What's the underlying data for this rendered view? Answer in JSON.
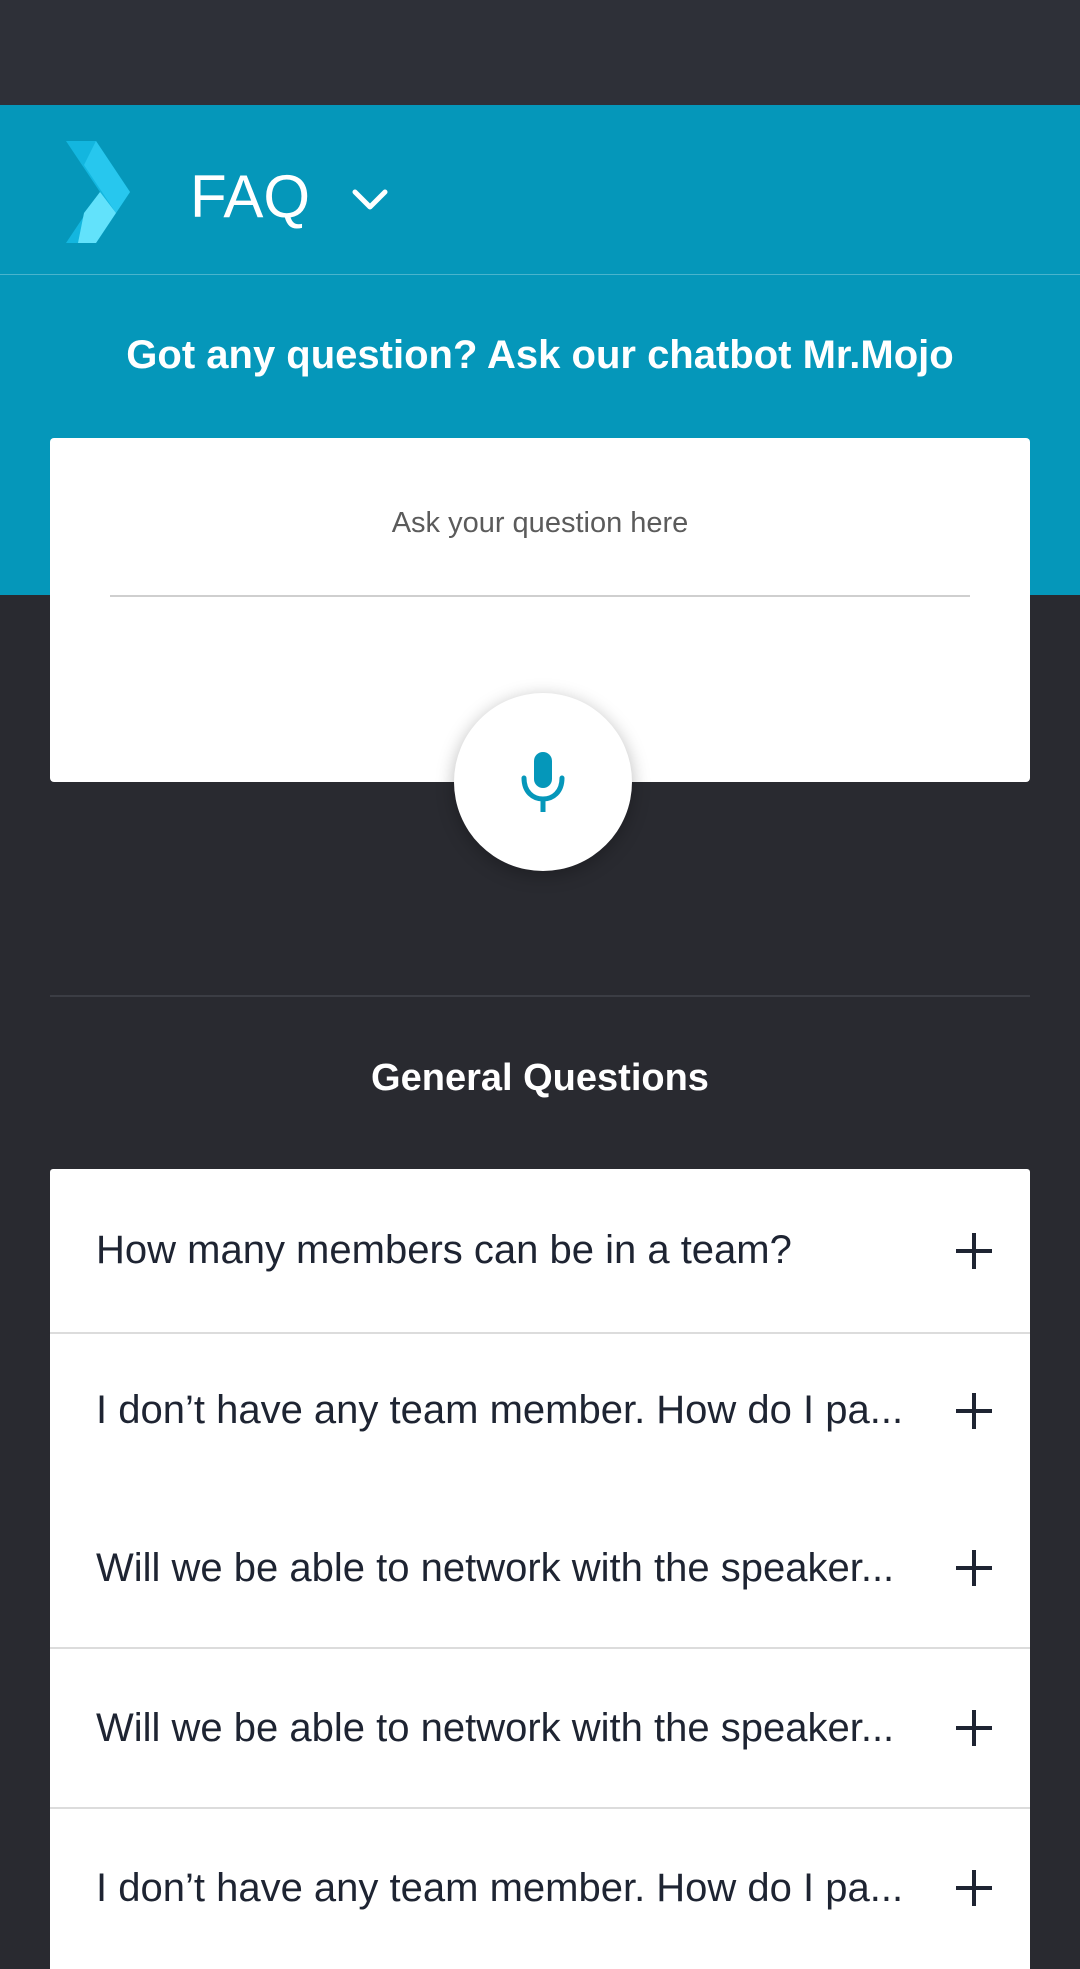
{
  "app_bar": {
    "title": "FAQ",
    "logo_icon": "chevron-logo-icon",
    "dropdown_icon": "chevron-down-icon",
    "color": "#0597ba"
  },
  "hero": {
    "heading": "Got any question? Ask our chatbot Mr.Mojo"
  },
  "ask": {
    "placeholder": "Ask your question here",
    "mic_icon": "microphone-icon"
  },
  "section": {
    "title": "General Questions"
  },
  "faq": {
    "items": [
      {
        "question": "How many members can be in a team?"
      },
      {
        "question": "I don’t have any team member. How do I pa..."
      },
      {
        "question": "Will we be able to network with the speaker..."
      },
      {
        "question": "Will we be able to network with the speaker..."
      },
      {
        "question": "I don’t have any team member. How do I pa..."
      }
    ],
    "expand_icon": "plus-icon"
  }
}
